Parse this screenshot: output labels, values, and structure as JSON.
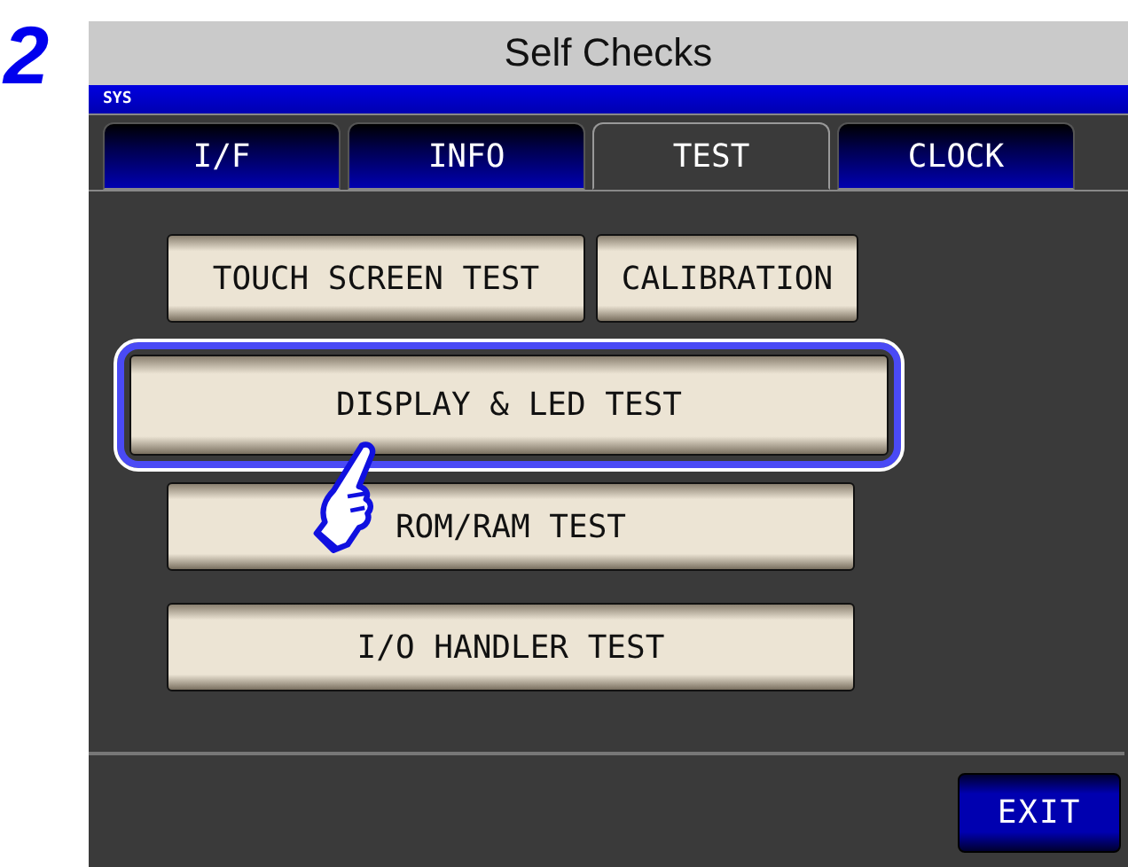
{
  "step_number": "2",
  "window": {
    "title": "Self Checks",
    "mode_label": "SYS"
  },
  "tabs": [
    {
      "label": "I/F",
      "selected": false
    },
    {
      "label": "INFO",
      "selected": false
    },
    {
      "label": "TEST",
      "selected": true
    },
    {
      "label": "CLOCK",
      "selected": false
    }
  ],
  "test_button_rows": [
    [
      {
        "label": "TOUCH SCREEN TEST",
        "highlighted": false
      },
      {
        "label": "CALIBRATION",
        "highlighted": false
      }
    ],
    [
      {
        "label": "DISPLAY & LED TEST",
        "highlighted": true
      }
    ],
    [
      {
        "label": "ROM/RAM TEST",
        "highlighted": false
      }
    ],
    [
      {
        "label": "I/O HANDLER TEST",
        "highlighted": false
      }
    ]
  ],
  "exit_button": "EXIT"
}
